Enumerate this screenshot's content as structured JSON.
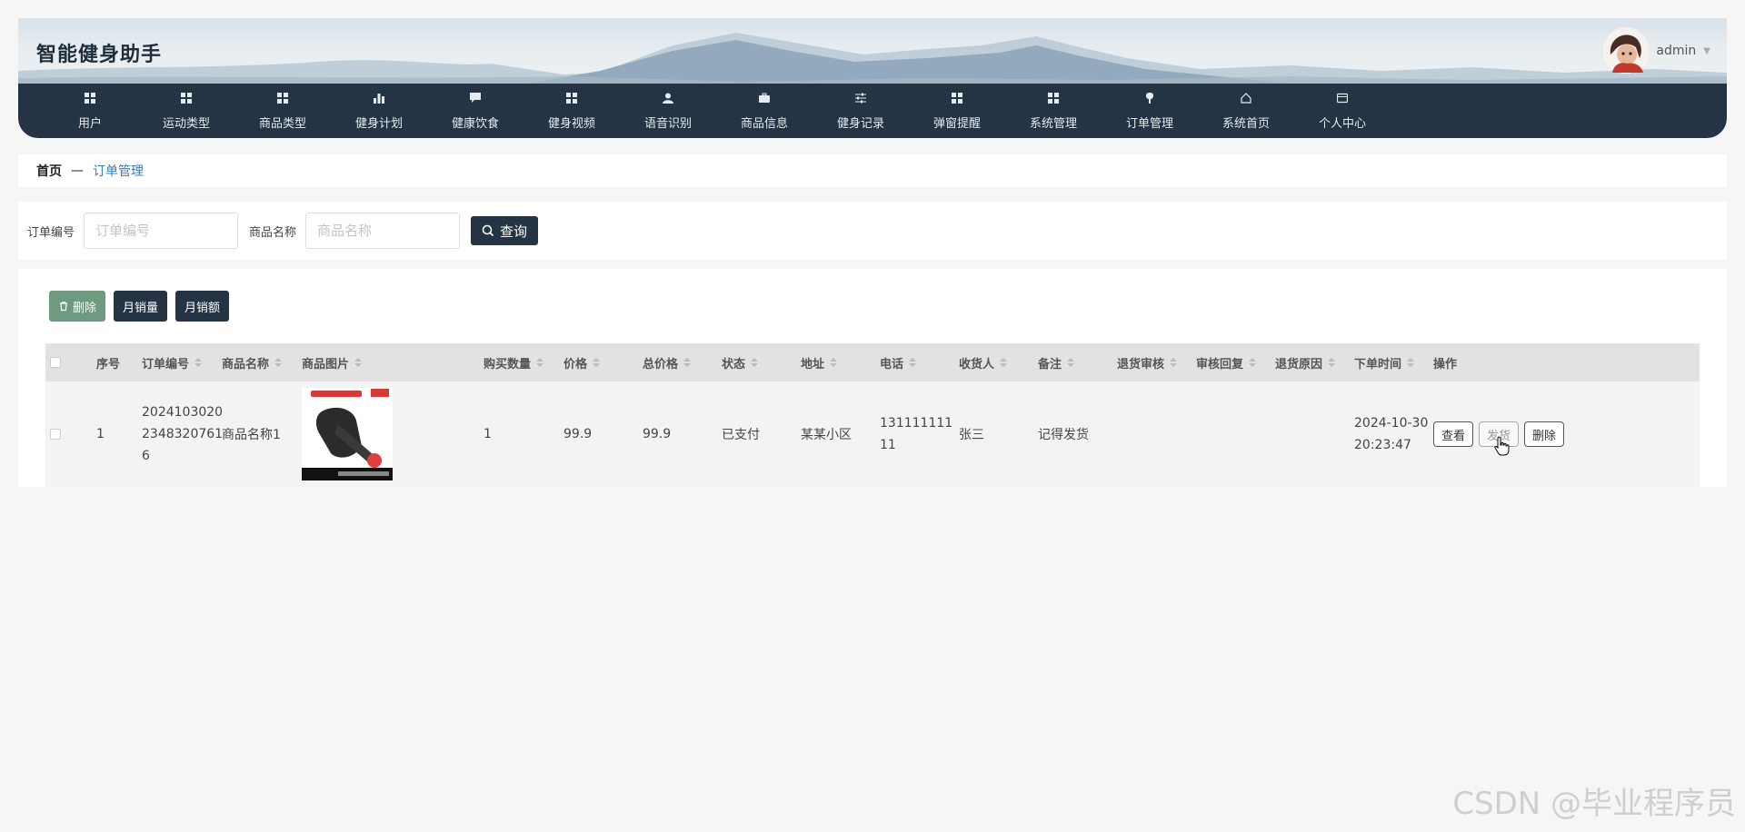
{
  "app": {
    "title": "智能健身助手",
    "username": "admin"
  },
  "nav": [
    {
      "label": "用户",
      "icon": "grid-icon"
    },
    {
      "label": "运动类型",
      "icon": "grid-icon"
    },
    {
      "label": "商品类型",
      "icon": "grid-icon"
    },
    {
      "label": "健身计划",
      "icon": "bar-chart-icon"
    },
    {
      "label": "健康饮食",
      "icon": "chat-icon"
    },
    {
      "label": "健身视频",
      "icon": "grid-icon"
    },
    {
      "label": "语音识别",
      "icon": "user-icon"
    },
    {
      "label": "商品信息",
      "icon": "briefcase-icon"
    },
    {
      "label": "健身记录",
      "icon": "sliders-icon"
    },
    {
      "label": "弹窗提醒",
      "icon": "grid-icon"
    },
    {
      "label": "系统管理",
      "icon": "grid-icon"
    },
    {
      "label": "订单管理",
      "icon": "popsicle-icon"
    },
    {
      "label": "系统首页",
      "icon": "home-icon"
    },
    {
      "label": "个人中心",
      "icon": "card-icon"
    }
  ],
  "breadcrumb": {
    "home": "首页",
    "sep": "—",
    "current": "订单管理"
  },
  "search": {
    "order_no_label": "订单编号",
    "order_no_placeholder": "订单编号",
    "product_name_label": "商品名称",
    "product_name_placeholder": "商品名称",
    "query_label": "查询"
  },
  "toolbar": {
    "delete_label": "删除",
    "monthly_sales_label": "月销量",
    "monthly_revenue_label": "月销额"
  },
  "table": {
    "headers": [
      "序号",
      "订单编号",
      "商品名称",
      "商品图片",
      "购买数量",
      "价格",
      "总价格",
      "状态",
      "地址",
      "电话",
      "收货人",
      "备注",
      "退货审核",
      "审核回复",
      "退货原因",
      "下单时间",
      "操作"
    ],
    "rows": [
      {
        "index": "1",
        "order_no": [
          "2024103020",
          "2348320761",
          "6"
        ],
        "product_name": [
          "商品名称1"
        ],
        "quantity": "1",
        "price": "99.9",
        "total": "99.9",
        "status": "已支付",
        "address": "某某小区",
        "phone": [
          "131111111",
          "11"
        ],
        "receiver": "张三",
        "remark": "记得发货",
        "return_review": "",
        "review_reply": "",
        "return_reason": "",
        "order_time": [
          "2024-10-30",
          "20:23:47"
        ],
        "actions": {
          "view": "查看",
          "ship": "发货",
          "delete": "删除"
        }
      }
    ]
  },
  "watermark": "CSDN @毕业程序员",
  "colors": {
    "primary": "#243444",
    "accent": "#3b7fb0",
    "delete_green": "#6e9a80"
  }
}
